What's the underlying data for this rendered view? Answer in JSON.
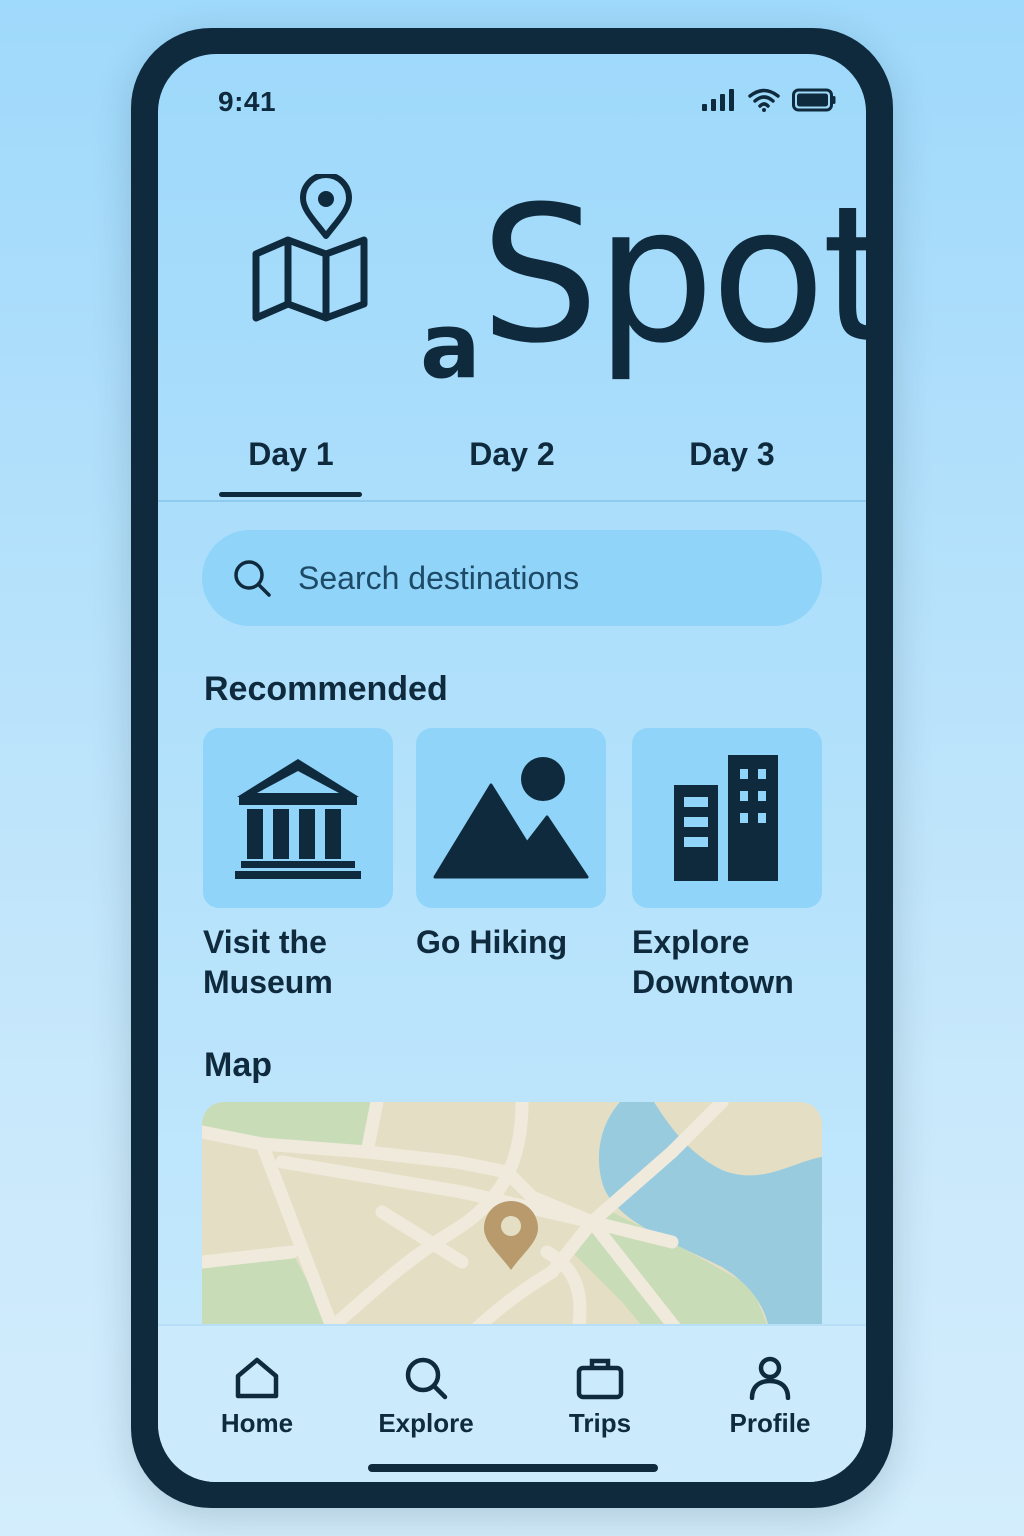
{
  "status_bar": {
    "time": "9:41",
    "icons": [
      "signal-icon",
      "wifi-icon",
      "battery-icon"
    ]
  },
  "logo": {
    "prefix": "a",
    "word": "Spot",
    "icon": "map-pin-icon"
  },
  "tabs": [
    {
      "label": "Day 1",
      "active": true
    },
    {
      "label": "Day 2",
      "active": false
    },
    {
      "label": "Day 3",
      "active": false
    }
  ],
  "search": {
    "placeholder": "Search destinations",
    "value": ""
  },
  "recommended": {
    "title": "Recommended",
    "items": [
      {
        "label_line1": "Visit the",
        "label_line2": "Museum",
        "icon": "museum-icon"
      },
      {
        "label_line1": "Go Hiking",
        "label_line2": "",
        "icon": "mountain-icon"
      },
      {
        "label_line1": "Explore",
        "label_line2": "Downtown",
        "icon": "buildings-icon"
      }
    ]
  },
  "map": {
    "title": "Map"
  },
  "bottom_nav": [
    {
      "label": "Home",
      "icon": "home-icon"
    },
    {
      "label": "Explore",
      "icon": "search-icon"
    },
    {
      "label": "Trips",
      "icon": "briefcase-icon"
    },
    {
      "label": "Profile",
      "icon": "profile-icon"
    }
  ],
  "colors": {
    "background": "#9fd9fb",
    "ink": "#0f2a3d",
    "tile": "#90d4f9",
    "map_land": "#e4dfc4",
    "map_park": "#c9dcb8",
    "map_water": "#99cbdf",
    "map_pin": "#b89a6c"
  }
}
